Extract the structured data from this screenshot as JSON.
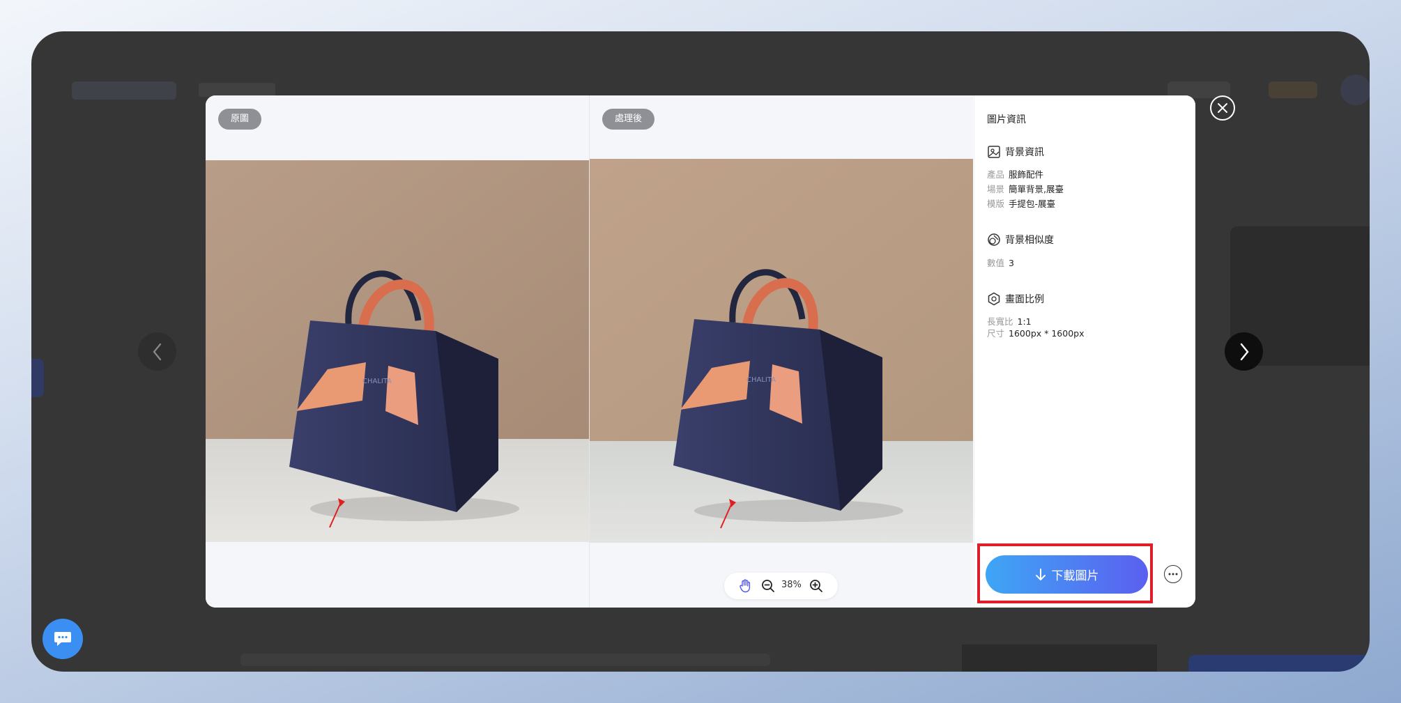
{
  "left_pane": {
    "tag": "原圖"
  },
  "right_pane": {
    "tag": "處理後"
  },
  "zoom": {
    "value": "38%"
  },
  "info": {
    "title": "圖片資訊",
    "background": {
      "heading": "背景資訊",
      "product_label": "產品",
      "product_value": "服飾配件",
      "scene_label": "場景",
      "scene_value": "簡單背景,展臺",
      "template_label": "模版",
      "template_value": "手提包-展臺"
    },
    "similarity": {
      "heading": "背景相似度",
      "value_label": "數值",
      "value": "3"
    },
    "ratio": {
      "heading": "畫面比例",
      "aspect_label": "長寬比",
      "aspect_value": "1:1",
      "size_label": "尺寸",
      "size_value": "1600px * 1600px"
    }
  },
  "download_button": {
    "label": "下載圖片"
  },
  "colors": {
    "accent_start": "#3ea6f5",
    "accent_end": "#5b5ff0",
    "highlight": "#e11d2a"
  },
  "icons": [
    "chevron-left-icon",
    "chevron-right-icon",
    "close-icon",
    "hand-icon",
    "zoom-out-icon",
    "zoom-in-icon",
    "image-icon",
    "similarity-icon",
    "ratio-icon",
    "download-icon",
    "more-icon",
    "chat-icon"
  ]
}
